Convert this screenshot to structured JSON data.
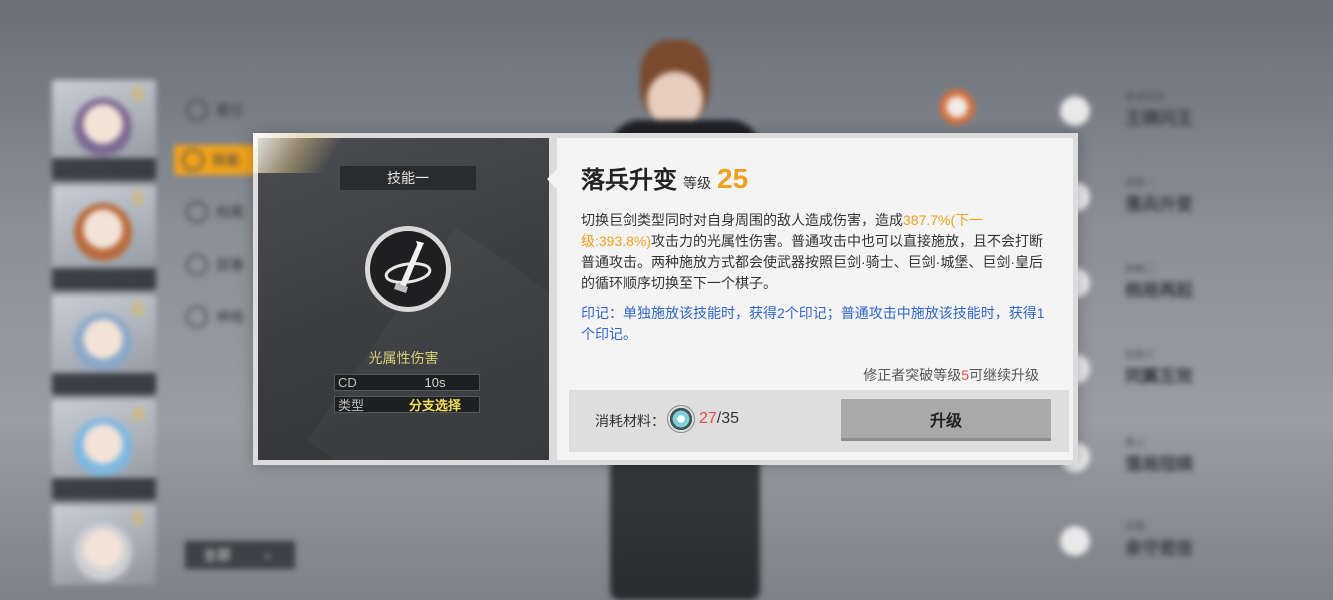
{
  "background": {
    "side_menu": [
      {
        "label": "震位"
      },
      {
        "label": "技能"
      },
      {
        "label": "档案"
      },
      {
        "label": "部署"
      },
      {
        "label": "神格"
      }
    ],
    "all_button": {
      "label": "全部"
    },
    "skill_list": [
      {
        "small": "普通攻击",
        "big": "王棋问王"
      },
      {
        "small": "技能一",
        "big": "落兵升变"
      },
      {
        "small": "技能二",
        "big": "档局再起"
      },
      {
        "small": "技能三",
        "big": "同翼互效"
      },
      {
        "small": "奥义",
        "big": "落局冠棋"
      },
      {
        "small": "天赋",
        "big": "亲守君信"
      }
    ]
  },
  "dialog": {
    "slot_label": "技能一",
    "skill_icon": "sword-swirl-icon",
    "damage_type": "光属性伤害",
    "stats": [
      {
        "key": "CD",
        "value": "10s"
      },
      {
        "key": "类型",
        "value": "分支选择"
      }
    ],
    "title": "落兵升变",
    "level_label": "等级",
    "level": "25",
    "desc_1": "切换巨剑类型同时对自身周围的敌人造成伤害，造成",
    "desc_pct": "387.7%(下一级:393.8%)",
    "desc_2": "攻击力的光属性伤害。普通攻击中也可以直接施放，且不会打断普通攻击。两种施放方式都会使武器按照巨剑·骑士、巨剑·城堡、巨剑·皇后的循环顺序切换至下一个棋子。",
    "mark_text": "印记：单独施放该技能时，获得2个印记；普通攻击中施放该技能时，获得1个印记。",
    "req_prefix": "修正者突破等级",
    "req_level": "5",
    "req_suffix": "可继续升级",
    "material_label": "消耗材料：",
    "material_icon": "skill-material-icon",
    "material_have": "27",
    "material_need": "/35",
    "upgrade_label": "升级"
  },
  "colors": {
    "accent_orange": "#f0a020",
    "mark_blue": "#2f66c9",
    "warn_red": "#e34b4b",
    "damage_type_yellow": "#d7cf76"
  }
}
